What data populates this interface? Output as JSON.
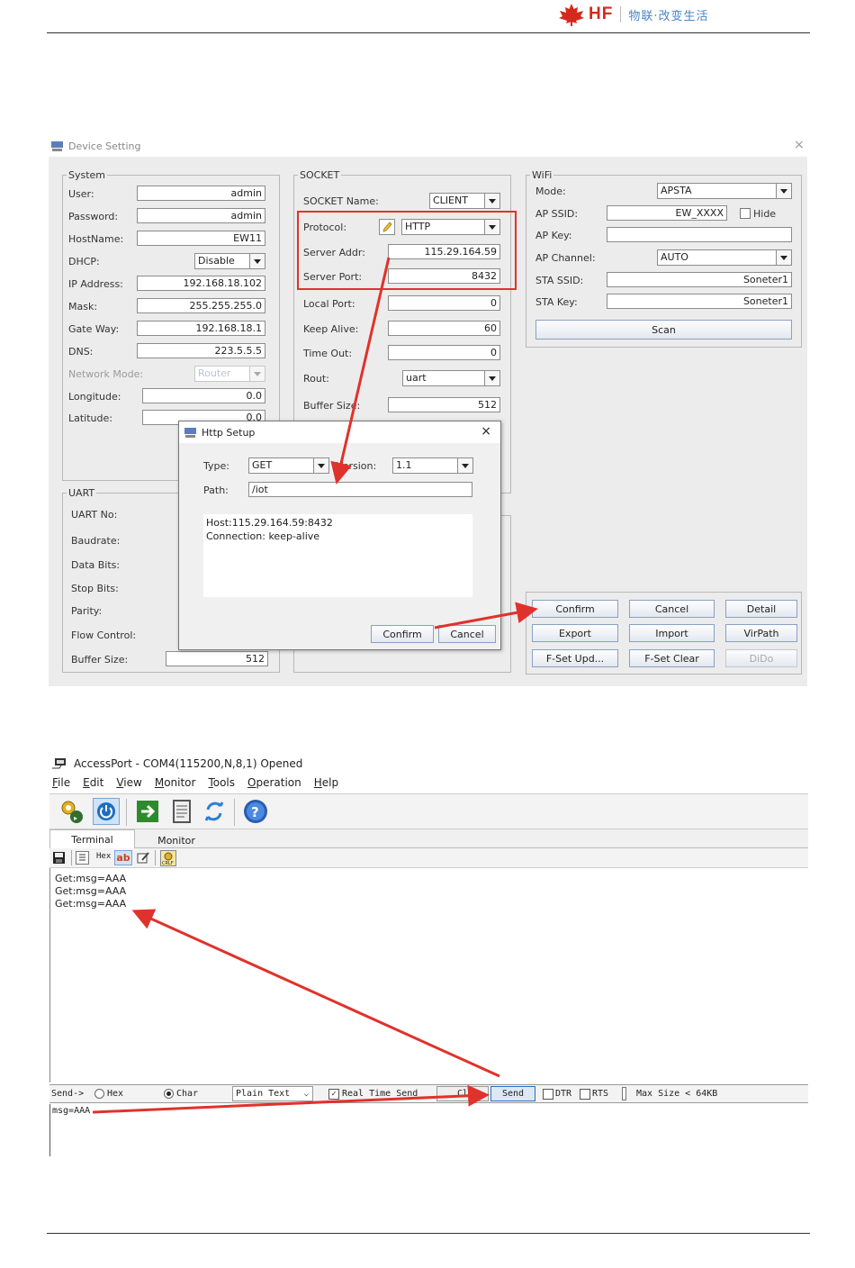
{
  "header": {
    "brand": "HF",
    "slogan": "物联·改变生活"
  },
  "device_setting": {
    "title": "Device Setting",
    "close": "×",
    "system": {
      "legend": "System",
      "fields": [
        {
          "label": "User:",
          "value": "admin"
        },
        {
          "label": "Password:",
          "value": "admin"
        },
        {
          "label": "HostName:",
          "value": "EW11"
        },
        {
          "label": "DHCP:",
          "value": "Disable"
        },
        {
          "label": "IP Address:",
          "value": "192.168.18.102"
        },
        {
          "label": "Mask:",
          "value": "255.255.255.0"
        },
        {
          "label": "Gate Way:",
          "value": "192.168.18.1"
        },
        {
          "label": "DNS:",
          "value": "223.5.5.5"
        },
        {
          "label": "Network Mode:",
          "value": "Router"
        },
        {
          "label": "Longitude:",
          "value": "0.0"
        },
        {
          "label": "Latitude:",
          "value": "0.0"
        }
      ]
    },
    "uart": {
      "legend": "UART",
      "labels": [
        "UART No:",
        "Baudrate:",
        "Data Bits:",
        "Stop Bits:",
        "Parity:",
        "Flow Control:",
        "Buffer Size:"
      ],
      "buffer_size": "512"
    },
    "socket": {
      "legend": "SOCKET",
      "fields": [
        {
          "label": "SOCKET Name:",
          "value": "CLIENT"
        },
        {
          "label": "Protocol:",
          "value": "HTTP"
        },
        {
          "label": "Server Addr:",
          "value": "115.29.164.59"
        },
        {
          "label": "Server Port:",
          "value": "8432"
        },
        {
          "label": "Local Port:",
          "value": "0"
        },
        {
          "label": "Keep Alive:",
          "value": "60"
        },
        {
          "label": "Time Out:",
          "value": "0"
        },
        {
          "label": "Rout:",
          "value": "uart"
        },
        {
          "label": "Buffer Size:",
          "value": "512"
        }
      ]
    },
    "wifi": {
      "legend": "WiFi",
      "fields": [
        {
          "label": "Mode:",
          "value": "APSTA"
        },
        {
          "label": "AP SSID:",
          "value": "EW_XXXX"
        },
        {
          "label": "AP Key:",
          "value": ""
        },
        {
          "label": "AP Channel:",
          "value": "AUTO"
        },
        {
          "label": "STA SSID:",
          "value": "Soneter1"
        },
        {
          "label": "STA Key:",
          "value": "Soneter1"
        }
      ],
      "hide_label": "Hide",
      "scan": "Scan"
    },
    "buttons": [
      "Confirm",
      "Cancel",
      "Detail",
      "Export",
      "Import",
      "VirPath",
      "F-Set Upd...",
      "F-Set Clear",
      "DiDo"
    ]
  },
  "http_setup": {
    "title": "Http Setup",
    "close": "×",
    "type_label": "Type:",
    "type_value": "GET",
    "version_label": "Version:",
    "version_value": "1.1",
    "path_label": "Path:",
    "path_value": "/iot",
    "headers": "Host:115.29.164.59:8432\nConnection: keep-alive",
    "confirm": "Confirm",
    "cancel": "Cancel"
  },
  "accessport": {
    "title": "AccessPort - COM4(115200,N,8,1) Opened",
    "menu": [
      {
        "key": "F",
        "rest": "ile"
      },
      {
        "key": "E",
        "rest": "dit"
      },
      {
        "key": "V",
        "rest": "iew"
      },
      {
        "key": "M",
        "rest": "onitor"
      },
      {
        "key": "T",
        "rest": "ools"
      },
      {
        "key": "O",
        "rest": "peration"
      },
      {
        "key": "H",
        "rest": "elp"
      }
    ],
    "tabs": [
      "Terminal",
      "Monitor"
    ],
    "hex_label": "Hex",
    "ab_label": "ab",
    "terminal_lines": "Get:msg=AAA\nGet:msg=AAA\nGet:msg=AAA",
    "send_bar": {
      "send_arrow": "Send->",
      "hex": "Hex",
      "char": "Char",
      "format": "Plain Text",
      "realtime": "Real Time Send",
      "clear": "Cl",
      "send": "Send",
      "dtr": "DTR",
      "rts": "RTS",
      "max_size": "Max Size < 64KB"
    },
    "send_text": "msg=AAA"
  },
  "colors": {
    "annotation_red": "#e0322c",
    "brand_red": "#d42a1e",
    "slogan_blue": "#4a86c5"
  }
}
